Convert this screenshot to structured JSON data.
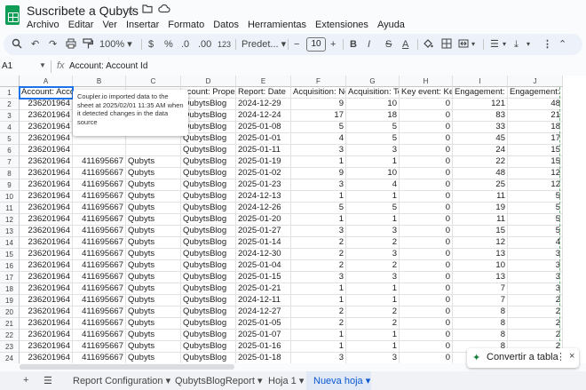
{
  "title": "Suscribete a Qubyts",
  "icons": [
    "star-icon",
    "folder-move-icon",
    "cloud-status-icon"
  ],
  "menu": [
    "Archivo",
    "Editar",
    "Ver",
    "Insertar",
    "Formato",
    "Datos",
    "Herramientas",
    "Extensiones",
    "Ayuda"
  ],
  "toolbar": {
    "zoom": "100%",
    "currency": "$",
    "percent": "%",
    "dec_decrease": ".0",
    "dec_increase": ".00",
    "number_format": "123",
    "font": "Predet...",
    "font_size": "10",
    "bold": "B",
    "italic": "I",
    "strike": "S",
    "text_color": "A"
  },
  "formula_bar": {
    "cell_ref": "A1",
    "fx": "fx",
    "content": "Account: Account Id"
  },
  "tooltip": "Coupler.io imported data to the sheet at 2025/02/01 11:35 AM when it detected changes in the data source",
  "columns": [
    "A",
    "B",
    "C",
    "D",
    "E",
    "F",
    "G",
    "H",
    "I",
    "J"
  ],
  "header_row": [
    "Account: Accoun",
    "",
    "",
    "ccount: Proper",
    "Report: Date",
    "Acquisition: New",
    "Acquisition: Tota",
    "Key event: Key e",
    "Engagement: Ev",
    "Engagement: Views"
  ],
  "rows": [
    [
      "236201964",
      "",
      "",
      "QubytsBlog",
      "2024-12-29",
      "9",
      "10",
      "0",
      "121",
      "48"
    ],
    [
      "236201964",
      "",
      "",
      "QubytsBlog",
      "2024-12-24",
      "17",
      "18",
      "0",
      "83",
      "21"
    ],
    [
      "236201964",
      "",
      "",
      "QubytsBlog",
      "2025-01-08",
      "5",
      "5",
      "0",
      "33",
      "18"
    ],
    [
      "236201964",
      "",
      "",
      "QubytsBlog",
      "2025-01-01",
      "4",
      "5",
      "0",
      "45",
      "17"
    ],
    [
      "236201964",
      "",
      "",
      "QubytsBlog",
      "2025-01-11",
      "3",
      "3",
      "0",
      "24",
      "15"
    ],
    [
      "236201964",
      "411695667",
      "Qubyts",
      "QubytsBlog",
      "2025-01-19",
      "1",
      "1",
      "0",
      "22",
      "15"
    ],
    [
      "236201964",
      "411695667",
      "Qubyts",
      "QubytsBlog",
      "2025-01-02",
      "9",
      "10",
      "0",
      "48",
      "12"
    ],
    [
      "236201964",
      "411695667",
      "Qubyts",
      "QubytsBlog",
      "2025-01-23",
      "3",
      "4",
      "0",
      "25",
      "12"
    ],
    [
      "236201964",
      "411695667",
      "Qubyts",
      "QubytsBlog",
      "2024-12-13",
      "1",
      "1",
      "0",
      "11",
      "5"
    ],
    [
      "236201964",
      "411695667",
      "Qubyts",
      "QubytsBlog",
      "2024-12-26",
      "5",
      "5",
      "0",
      "19",
      "5"
    ],
    [
      "236201964",
      "411695667",
      "Qubyts",
      "QubytsBlog",
      "2025-01-20",
      "1",
      "1",
      "0",
      "11",
      "5"
    ],
    [
      "236201964",
      "411695667",
      "Qubyts",
      "QubytsBlog",
      "2025-01-27",
      "3",
      "3",
      "0",
      "15",
      "5"
    ],
    [
      "236201964",
      "411695667",
      "Qubyts",
      "QubytsBlog",
      "2025-01-14",
      "2",
      "2",
      "0",
      "12",
      "4"
    ],
    [
      "236201964",
      "411695667",
      "Qubyts",
      "QubytsBlog",
      "2024-12-30",
      "2",
      "3",
      "0",
      "13",
      "3"
    ],
    [
      "236201964",
      "411695667",
      "Qubyts",
      "QubytsBlog",
      "2025-01-04",
      "2",
      "2",
      "0",
      "10",
      "3"
    ],
    [
      "236201964",
      "411695667",
      "Qubyts",
      "QubytsBlog",
      "2025-01-15",
      "3",
      "3",
      "0",
      "13",
      "3"
    ],
    [
      "236201964",
      "411695667",
      "Qubyts",
      "QubytsBlog",
      "2025-01-21",
      "1",
      "1",
      "0",
      "7",
      "3"
    ],
    [
      "236201964",
      "411695667",
      "Qubyts",
      "QubytsBlog",
      "2024-12-11",
      "1",
      "1",
      "0",
      "7",
      "2"
    ],
    [
      "236201964",
      "411695667",
      "Qubyts",
      "QubytsBlog",
      "2024-12-27",
      "2",
      "2",
      "0",
      "8",
      "2"
    ],
    [
      "236201964",
      "411695667",
      "Qubyts",
      "QubytsBlog",
      "2025-01-05",
      "2",
      "2",
      "0",
      "8",
      "2"
    ],
    [
      "236201964",
      "411695667",
      "Qubyts",
      "QubytsBlog",
      "2025-01-07",
      "1",
      "1",
      "0",
      "8",
      "2"
    ],
    [
      "236201964",
      "411695667",
      "Qubyts",
      "QubytsBlog",
      "2025-01-16",
      "1",
      "1",
      "0",
      "8",
      "2"
    ],
    [
      "236201964",
      "411695667",
      "Qubyts",
      "QubytsBlog",
      "2025-01-18",
      "3",
      "3",
      "0",
      "13",
      "2"
    ]
  ],
  "row_numbers": [
    "1",
    "2",
    "3",
    "4",
    "5",
    "6",
    "7",
    "8",
    "9",
    "10",
    "11",
    "12",
    "13",
    "14",
    "15",
    "16",
    "17",
    "18",
    "19",
    "20",
    "21",
    "22",
    "23",
    "24"
  ],
  "tabs": {
    "add": "+",
    "all_sheets": "☰",
    "sheets": [
      "Report Configuration",
      "QubytsBlogReport",
      "Hoja 1"
    ],
    "active": "Nueva hoja"
  },
  "convert_button": {
    "label": "Convertir a tabla",
    "menu": "⋮",
    "close": "×"
  },
  "colors": {
    "accent": "#1a73e8",
    "sheets_green": "#0f9d58",
    "active_tab": "#0b57d0"
  }
}
